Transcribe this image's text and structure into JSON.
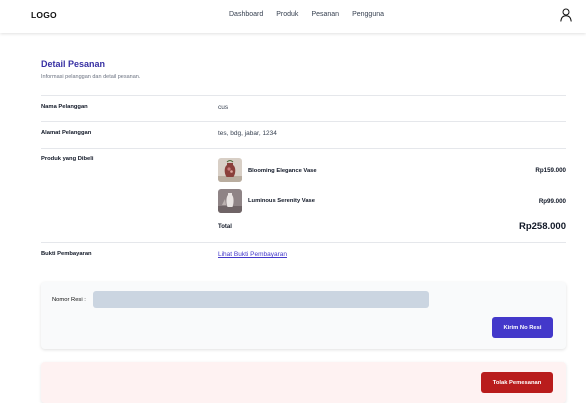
{
  "navbar": {
    "logo": "LOGO",
    "links": [
      "Dashboard",
      "Produk",
      "Pesanan",
      "Pengguna"
    ],
    "user_icon": "user-icon"
  },
  "detail": {
    "title": "Detail Pesanan",
    "subtitle": "Informasi pelanggan dan detail pesanan."
  },
  "fields": {
    "customer_name_label": "Nama Pelanggan",
    "customer_name_value": "cus",
    "address_label": "Alamat Pelanggan",
    "address_value": "tes, bdg, jabar, 1234",
    "products_label": "Produk yang Dibeli",
    "payment_label": "Bukti Pembayaran",
    "payment_link": "Lihat Bukti Pembayaran"
  },
  "products": [
    {
      "name": "Blooming Elegance Vase",
      "price": "Rp159.000"
    },
    {
      "name": "Luminous Serenity Vase",
      "price": "Rp99.000"
    }
  ],
  "total": {
    "label": "Total",
    "value": "Rp258.000"
  },
  "resi": {
    "label": "Nomor Resi :",
    "value": "",
    "placeholder": "",
    "button": "Kirim No Resi"
  },
  "reject": {
    "button": "Tolak Pemesanan"
  },
  "colors": {
    "accent": "#4338ca",
    "title": "#3730a3",
    "danger": "#b91c1c",
    "input_bg": "#cbd5e1",
    "reject_bg": "#fef2f2"
  }
}
